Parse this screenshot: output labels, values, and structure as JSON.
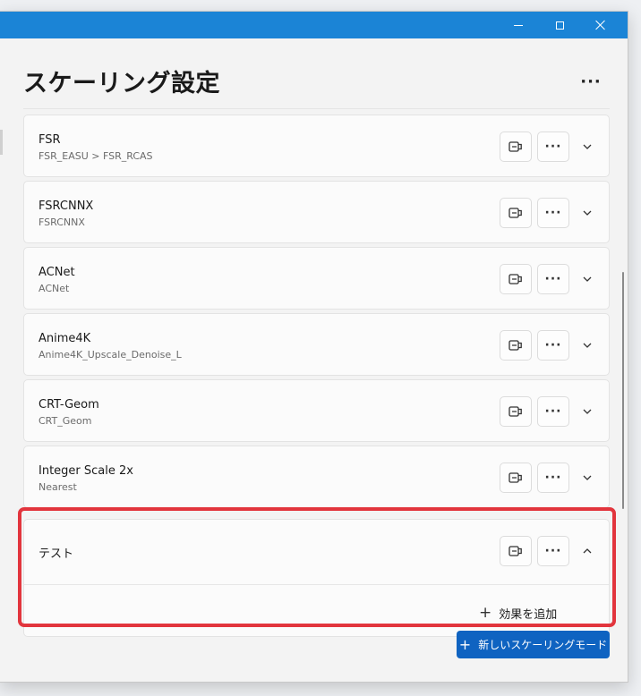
{
  "window": {
    "title": "スケーリング設定",
    "caption_buttons": [
      "minimize-icon",
      "maximize-icon",
      "close-icon"
    ]
  },
  "header": {
    "more_label": "···"
  },
  "modes": [
    {
      "name": "FSR",
      "effects": "FSR_EASU > FSR_RCAS"
    },
    {
      "name": "FSRCNNX",
      "effects": "FSRCNNX"
    },
    {
      "name": "ACNet",
      "effects": "ACNet"
    },
    {
      "name": "Anime4K",
      "effects": "Anime4K_Upscale_Denoise_L"
    },
    {
      "name": "CRT-Geom",
      "effects": "CRT_Geom"
    },
    {
      "name": "Integer Scale 2x",
      "effects": "Nearest"
    }
  ],
  "expanded_mode": {
    "name": "テスト",
    "add_effect_label": "効果を追加"
  },
  "actions": {
    "more_label": "···",
    "new_mode_label": "新しいスケーリングモード",
    "plus_glyph": "+"
  },
  "colors": {
    "accent": "#1b84d6",
    "primary_button": "#0f63c1",
    "highlight": "#e2353d"
  }
}
